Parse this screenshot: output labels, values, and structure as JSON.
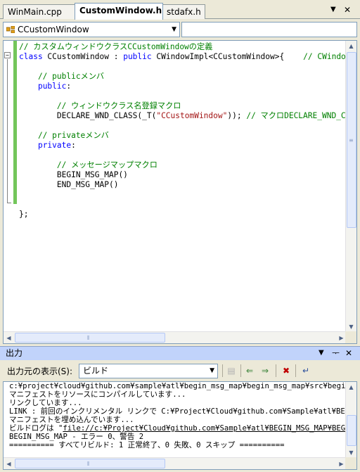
{
  "tabs": [
    {
      "label": "WinMain.cpp",
      "active": false
    },
    {
      "label": "CustomWindow.h",
      "active": true
    },
    {
      "label": "stdafx.h",
      "active": false
    }
  ],
  "tab_controls": {
    "dropdown": "▼",
    "close": "✕"
  },
  "navbar": {
    "class_combo": "CCustomWindow",
    "member_combo": ""
  },
  "code_lines": [
    [
      {
        "t": "// カスタムウィンドウクラスCCustomWindowの定義",
        "c": "c-comment"
      }
    ],
    [
      {
        "t": "class",
        "c": "c-kw"
      },
      {
        "t": " CCustomWindow : ",
        "c": "c-txt"
      },
      {
        "t": "public",
        "c": "c-kw"
      },
      {
        "t": " CWindowImpl<CCustomWindow>{    ",
        "c": "c-txt"
      },
      {
        "t": "// CWindowImpl",
        "c": "c-comment"
      }
    ],
    [
      {
        "t": "",
        "c": "c-txt"
      }
    ],
    [
      {
        "t": "    // publicメンバ",
        "c": "c-comment"
      }
    ],
    [
      {
        "t": "    ",
        "c": "c-txt"
      },
      {
        "t": "public",
        "c": "c-kw"
      },
      {
        "t": ":",
        "c": "c-txt"
      }
    ],
    [
      {
        "t": "",
        "c": "c-txt"
      }
    ],
    [
      {
        "t": "        // ウィンドウクラス名登録マクロ",
        "c": "c-comment"
      }
    ],
    [
      {
        "t": "        DECLARE_WND_CLASS(_T(",
        "c": "c-txt"
      },
      {
        "t": "\"CCustomWindow\"",
        "c": "c-str"
      },
      {
        "t": ")); ",
        "c": "c-txt"
      },
      {
        "t": "// マクロDECLARE_WND_CLASS",
        "c": "c-comment"
      }
    ],
    [
      {
        "t": "",
        "c": "c-txt"
      }
    ],
    [
      {
        "t": "    // privateメンバ",
        "c": "c-comment"
      }
    ],
    [
      {
        "t": "    ",
        "c": "c-txt"
      },
      {
        "t": "private",
        "c": "c-kw"
      },
      {
        "t": ":",
        "c": "c-txt"
      }
    ],
    [
      {
        "t": "",
        "c": "c-txt"
      }
    ],
    [
      {
        "t": "        // メッセージマップマクロ",
        "c": "c-comment"
      }
    ],
    [
      {
        "t": "        BEGIN_MSG_MAP()",
        "c": "c-txt"
      }
    ],
    [
      {
        "t": "        END_MSG_MAP()",
        "c": "c-txt"
      }
    ],
    [
      {
        "t": "",
        "c": "c-txt"
      }
    ],
    [
      {
        "t": "",
        "c": "c-txt"
      }
    ],
    [
      {
        "t": "};",
        "c": "c-txt"
      }
    ]
  ],
  "output": {
    "title": "出力",
    "show_from_label": "出力元の表示(S):",
    "source": "ビルド",
    "lines": [
      "c:¥project¥cloud¥github.com¥sample¥atl¥begin_msg_map¥begin_msg_map¥src¥begin_msg_map¥",
      "マニフェストをリソースにコンパイルしています...",
      "リンクしています...",
      "LINK : 前回のインクリメンタル リンクで C:¥Project¥Cloud¥github.com¥Sample¥atl¥BEGIN_MSG_",
      "マニフェストを埋め込んでいます...",
      "ビルドログは \"file://c:¥Project¥Cloud¥github.com¥Sample¥atl¥BEGIN_MSG_MAP¥BEGIN_MSG_MA",
      "BEGIN_MSG_MAP - エラー 0、警告 2",
      "========== すべてリビルド: 1 正常終了、0 失敗、0 スキップ ==========",
      ""
    ]
  }
}
